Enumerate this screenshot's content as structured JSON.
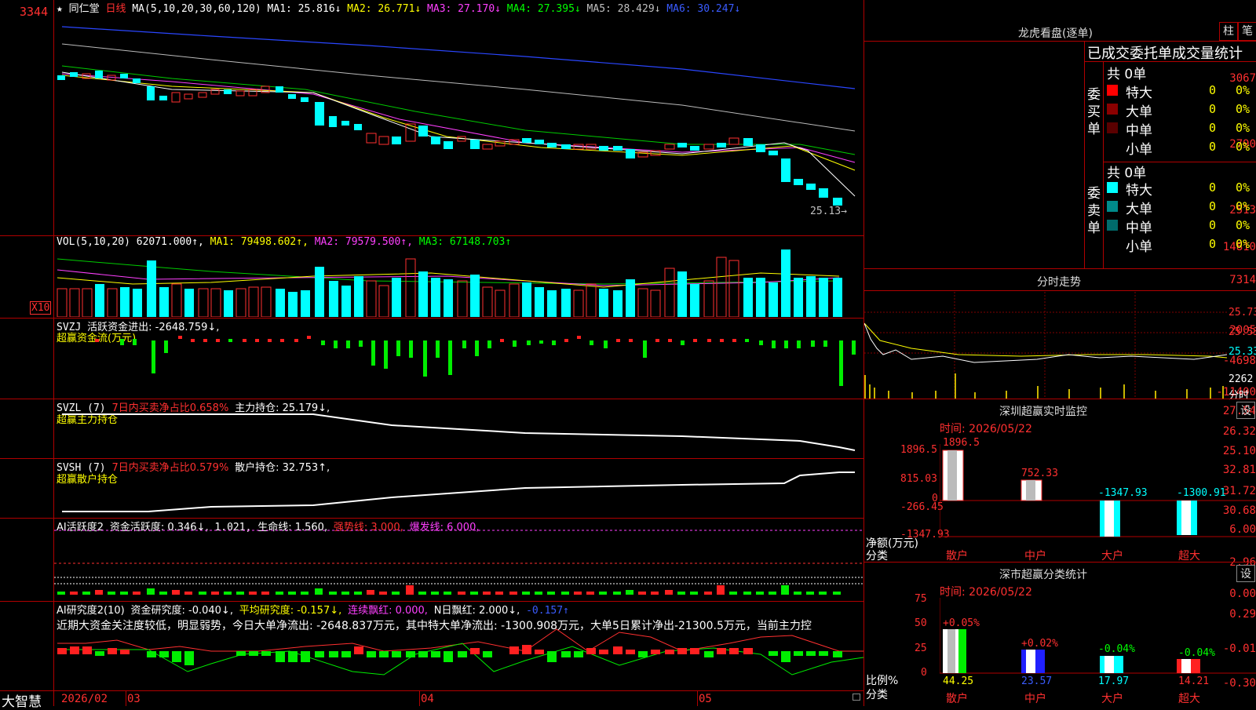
{
  "top_bar": {
    "axis_max": "3344",
    "star": "★",
    "stock_name": "同仁堂",
    "period": "日线",
    "ma_header": "MA(5,10,20,30,60,120)",
    "ma1": "MA1: 25.816↓",
    "ma2": "MA2: 26.771↓",
    "ma3": "MA3: 27.170↓",
    "ma4": "MA4: 27.395↓",
    "ma5": "MA5: 28.429↓",
    "ma6": "MA6: 30.247↓"
  },
  "price_axis": [
    "3067",
    "2790",
    "2513"
  ],
  "last_price_label": "25.13",
  "vol_pane": {
    "header": "VOL(5,10,20)",
    "value": "62071.000↑,",
    "ma1": "MA1: 79498.602↑,",
    "ma2": "MA2: 79579.500↑,",
    "ma3": "MA3: 67148.703↑",
    "axis": [
      "14810",
      "7314"
    ],
    "unit": "X10"
  },
  "svzj_pane": {
    "title": "SVZJ",
    "label": "活跃资金进出: -2648.759↓,",
    "subtitle": "超赢资金流(万元)",
    "axis": [
      "2005",
      "-4698",
      "-11400"
    ]
  },
  "svzl_pane": {
    "title": "SVZL (7)",
    "label1": "7日内买卖净占比0.658%",
    "label2": "主力持仓: 25.179↓,",
    "subtitle": "超赢主力持仓",
    "axis": [
      "27.54",
      "26.32",
      "25.10"
    ]
  },
  "svsh_pane": {
    "title": "SVSH (7)",
    "label1": "7日内买卖净占比0.579%",
    "label2": "散户持仓: 32.753↑,",
    "subtitle": "超赢散户持仓",
    "axis": [
      "32.81",
      "31.72",
      "30.68"
    ]
  },
  "ai_pane": {
    "title": "AI活跃度2",
    "label1": "资金活跃度: 0.346↓,",
    "label2": "1.021,",
    "label3": "生命线: 1.560,",
    "label4": "强势线: 3.000,",
    "label5": "爆发线: 6.000,",
    "axis": [
      "6.00",
      "2.96",
      "0.00"
    ]
  },
  "research_pane": {
    "title": "AI研究度2(10)",
    "label1": "资金研究度: -0.040↓,",
    "label2": "平均研究度: -0.157↓,",
    "label3": "连续飘红: 0.000,",
    "label4": "N日飘红: 2.000↓,",
    "label5": "-0.157↑",
    "comment": "近期大资金关注度较低，明显弱势，今日大单净流出: -2648.837万元，其中特大单净流出: -1300.908万元，大单5日累计净出-21300.5万元，当前主力控",
    "axis": [
      "0.29",
      "-0.01",
      "-0.30"
    ]
  },
  "bottom_bar": {
    "brand": "大智慧",
    "dates": [
      "2026/02",
      "03",
      "04",
      "05"
    ]
  },
  "right_panel": {
    "title": "龙虎看盘(逐单)",
    "btn1": "柱",
    "btn2": "笔",
    "header": "已成交委托单成交量统计",
    "buy": {
      "side_label": "委买单",
      "total": "共 0单",
      "rows": [
        {
          "name": "特大",
          "count": "0",
          "pct": "0%",
          "color": "#ff0000"
        },
        {
          "name": "大单",
          "count": "0",
          "pct": "0%",
          "color": "#8b0000"
        },
        {
          "name": "中单",
          "count": "0",
          "pct": "0%",
          "color": "#5a0000"
        },
        {
          "name": "小单",
          "count": "0",
          "pct": "0%",
          "color": "#000000"
        }
      ]
    },
    "sell": {
      "side_label": "委卖单",
      "total": "共 0单",
      "rows": [
        {
          "name": "特大",
          "count": "0",
          "pct": "0%",
          "color": "#00ffff"
        },
        {
          "name": "大单",
          "count": "0",
          "pct": "0%",
          "color": "#008b8b"
        },
        {
          "name": "中单",
          "count": "0",
          "pct": "0%",
          "color": "#006b6b"
        },
        {
          "name": "小单",
          "count": "0",
          "pct": "0%",
          "color": "#000000"
        }
      ]
    },
    "intraday": {
      "title": "分时走势",
      "axis": [
        "25.73",
        "25.53",
        "25.33",
        "2262"
      ],
      "footer": "分时"
    },
    "monitor": {
      "title": "深圳超赢实时监控",
      "btn": "设",
      "date": "时间: 2026/05/22",
      "axis": [
        "1896.5",
        "815.03",
        "0",
        "-266.45",
        "-1347.93"
      ],
      "side1": "净额(万元)",
      "side2": "分类",
      "bars": [
        {
          "label": "散户",
          "value": "1896.5"
        },
        {
          "label": "中户",
          "value": "752.33"
        },
        {
          "label": "大户",
          "value": "-1347.93"
        },
        {
          "label": "超大",
          "value": "-1300.91"
        }
      ]
    },
    "stats": {
      "title": "深市超赢分类统计",
      "btn": "设",
      "date": "时间: 2026/05/22",
      "axis": [
        "75",
        "50",
        "25",
        "0"
      ],
      "side1": "比例%",
      "side2": "分类",
      "bars": [
        {
          "label": "散户",
          "pct": "44.25",
          "delta": "+0.05%"
        },
        {
          "label": "中户",
          "pct": "23.57",
          "delta": "+0.02%"
        },
        {
          "label": "大户",
          "pct": "17.97",
          "delta": "-0.04%"
        },
        {
          "label": "超大",
          "pct": "14.21",
          "delta": "-0.04%"
        }
      ]
    }
  }
}
